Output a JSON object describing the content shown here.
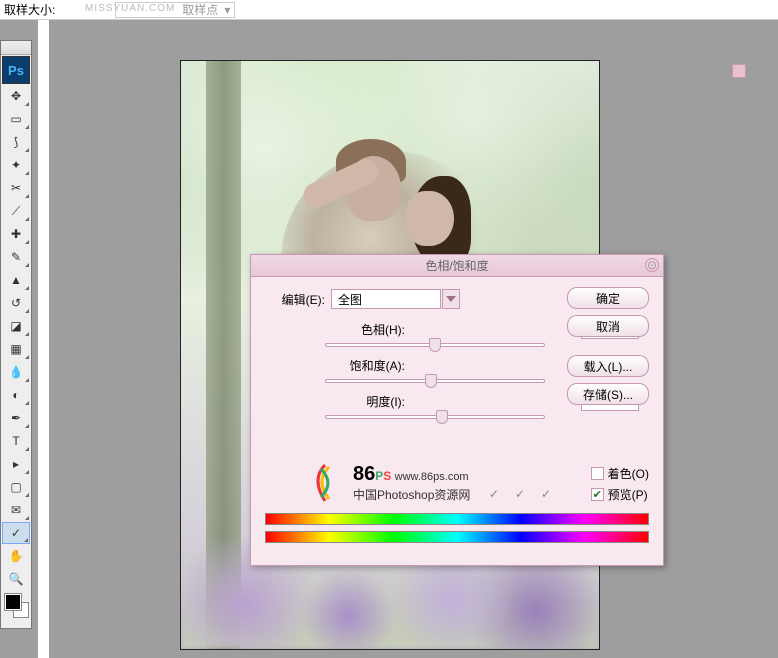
{
  "topbar": {
    "label": "取样大小:",
    "select_placeholder": "取样点"
  },
  "watermark_top": "MISSYUAN.COM",
  "ps_logo": "Ps",
  "dialog": {
    "title": "色相/饱和度",
    "edit_label": "编辑(E):",
    "edit_value": "全图",
    "hue_label": "色相(H):",
    "hue_value": "0",
    "sat_label": "饱和度(A):",
    "sat_value": "-4",
    "light_label": "明度(I):",
    "light_value": "+5",
    "ok": "确定",
    "cancel": "取消",
    "load": "载入(L)...",
    "save": "存储(S)...",
    "colorize": "着色(O)",
    "preview": "预览(P)"
  },
  "watermark": {
    "num": "86",
    "url": "www.86ps.com",
    "sub": "中国Photoshop资源网"
  }
}
